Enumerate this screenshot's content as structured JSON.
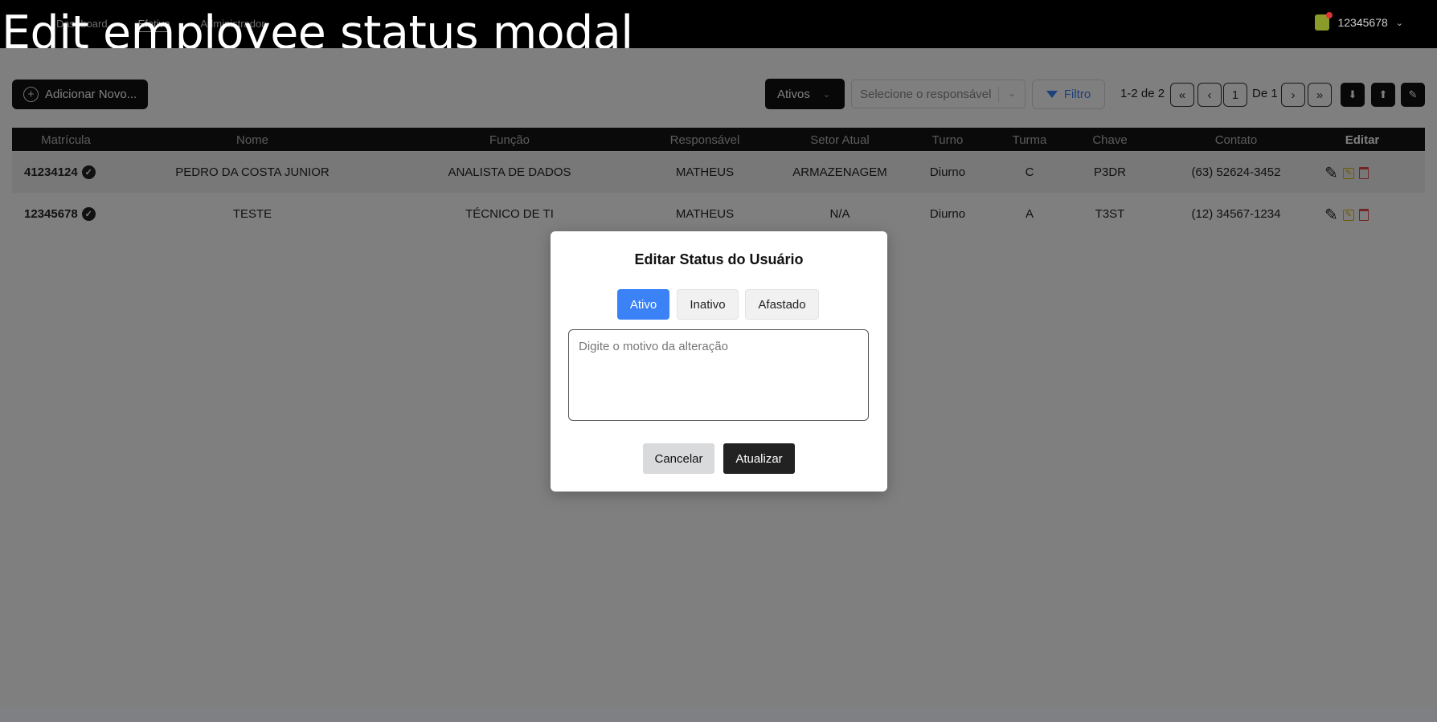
{
  "caption": "Edit employee status modal",
  "nav": [
    "Dashboard",
    "Efetivo",
    "Administrador"
  ],
  "user": {
    "id": "12345678"
  },
  "toolbar": {
    "add_label": "Adicionar Novo...",
    "status_select": "Ativos",
    "responsible_placeholder": "Selecione o responsável",
    "filter_label": "Filtro",
    "range": "1-2 de 2",
    "page": "1",
    "of_pages": "De 1"
  },
  "table": {
    "headers": [
      "Matrícula",
      "Nome",
      "Função",
      "Responsável",
      "Setor Atual",
      "Turno",
      "Turma",
      "Chave",
      "Contato",
      "Editar"
    ],
    "rows": [
      {
        "matricula": "41234124",
        "nome": "PEDRO DA COSTA JUNIOR",
        "funcao": "ANALISTA DE DADOS",
        "responsavel": "MATHEUS",
        "setor": "ARMAZENAGEM",
        "turno": "Diurno",
        "turma": "C",
        "chave": "P3DR",
        "contato": "(63) 52624-3452"
      },
      {
        "matricula": "12345678",
        "nome": "TESTE",
        "funcao": "TÉCNICO DE TI",
        "responsavel": "MATHEUS",
        "setor": "N/A",
        "turno": "Diurno",
        "turma": "A",
        "chave": "T3ST",
        "contato": "(12) 34567-1234"
      }
    ]
  },
  "modal": {
    "title": "Editar Status do Usuário",
    "options": [
      "Ativo",
      "Inativo",
      "Afastado"
    ],
    "selected": "Ativo",
    "reason_placeholder": "Digite o motivo da alteração",
    "cancel_label": "Cancelar",
    "update_label": "Atualizar"
  },
  "colors": {
    "accent": "#3b82f6",
    "dark": "#111111",
    "warning": "#e0b400",
    "danger": "#e24b4b"
  }
}
